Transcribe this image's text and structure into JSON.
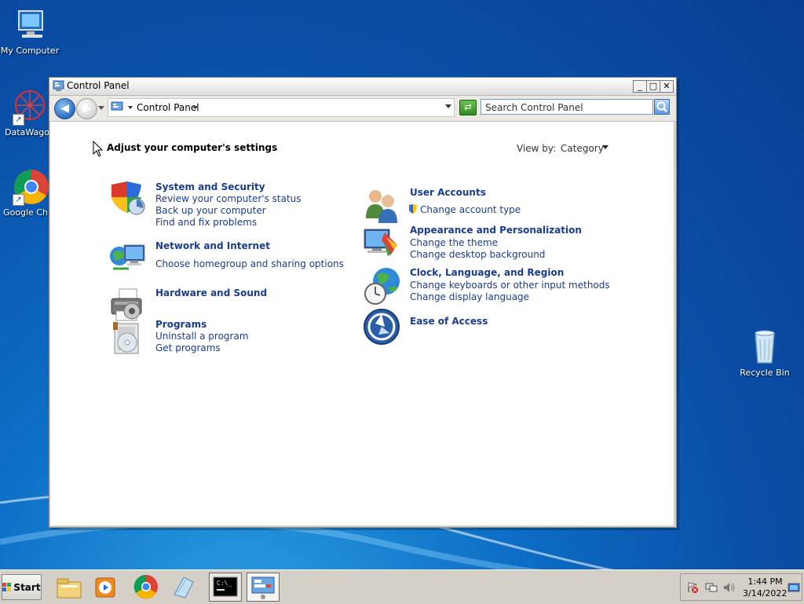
{
  "desktop": {
    "icons": [
      {
        "label": "My Computer",
        "icon": "computer-icon"
      },
      {
        "label": "DataWagon",
        "icon": "datawagon-icon"
      },
      {
        "label": "Google Chro",
        "icon": "chrome-icon"
      },
      {
        "label": "Recycle Bin",
        "icon": "recycle-bin-icon"
      }
    ]
  },
  "window": {
    "title": "Control Panel",
    "buttons": {
      "minimize": "_",
      "maximize": "□",
      "close": "✕"
    }
  },
  "navbar": {
    "breadcrumb": "Control Panel",
    "search_placeholder": "Search Control Panel"
  },
  "content": {
    "heading": "Adjust your computer's settings",
    "view_by_label": "View by:",
    "view_by_value": "Category",
    "categories_left": [
      {
        "title": "System and Security",
        "icon": "shield-icon",
        "links": [
          "Review your computer's status",
          "Back up your computer",
          "Find and fix problems"
        ]
      },
      {
        "title": "Network and Internet",
        "icon": "network-icon",
        "links": [
          "Choose homegroup and sharing options"
        ]
      },
      {
        "title": "Hardware and Sound",
        "icon": "printer-icon",
        "links": []
      },
      {
        "title": "Programs",
        "icon": "programs-icon",
        "links": [
          "Uninstall a program",
          "Get programs"
        ]
      }
    ],
    "categories_right": [
      {
        "title": "User Accounts",
        "icon": "users-icon",
        "links": [
          "Change account type"
        ]
      },
      {
        "title": "Appearance and Personalization",
        "icon": "monitor-paint-icon",
        "links": [
          "Change the theme",
          "Change desktop background"
        ]
      },
      {
        "title": "Clock, Language, and Region",
        "icon": "globe-clock-icon",
        "links": [
          "Change keyboards or other input methods",
          "Change display language"
        ]
      },
      {
        "title": "Ease of Access",
        "icon": "ease-of-access-icon",
        "links": []
      }
    ]
  },
  "taskbar": {
    "start_label": "Start",
    "apps": [
      "file-explorer-icon",
      "media-player-icon",
      "chrome-icon",
      "notepad-icon",
      "command-prompt-icon",
      "control-panel-icon"
    ],
    "clock_time": "1:44 PM",
    "clock_date": "3/14/2022"
  }
}
